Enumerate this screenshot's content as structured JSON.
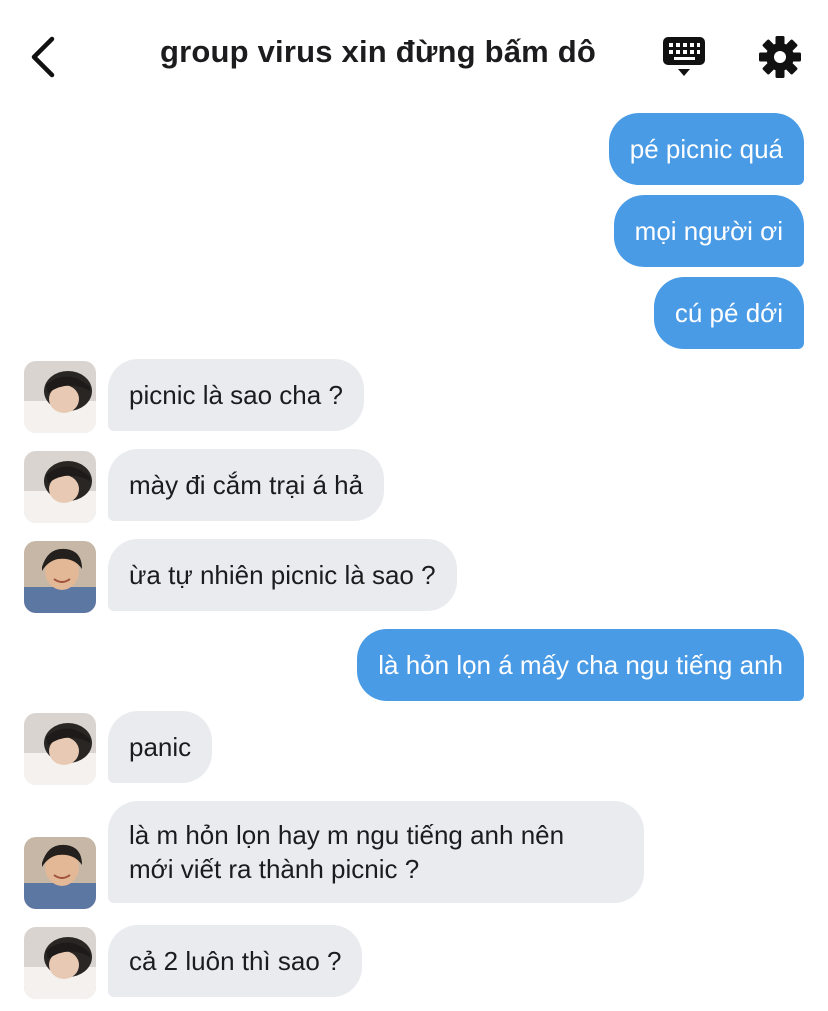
{
  "header": {
    "title": "group virus xin đừng bấm dô",
    "back_icon": "chevron-left-icon",
    "keyboard_icon": "keyboard-icon",
    "settings_icon": "gear-icon"
  },
  "colors": {
    "outgoing_bubble": "#4a9be6",
    "incoming_bubble": "#e9ebef",
    "text_dark": "#1c1c1e"
  },
  "messages": [
    {
      "direction": "out",
      "text": "pé picnic quá"
    },
    {
      "direction": "out",
      "text": "mọi người ơi"
    },
    {
      "direction": "out",
      "text": "cú pé dới"
    },
    {
      "direction": "in",
      "sender_avatar": "avatar-a",
      "text": "picnic là sao cha ?"
    },
    {
      "direction": "in",
      "sender_avatar": "avatar-a",
      "text": "mày đi cắm trại á hả"
    },
    {
      "direction": "in",
      "sender_avatar": "avatar-b",
      "text": "ừa tự nhiên picnic là sao ?"
    },
    {
      "direction": "out",
      "text": "là hỏn lọn á mấy cha ngu tiếng anh"
    },
    {
      "direction": "in",
      "sender_avatar": "avatar-a",
      "text": "panic"
    },
    {
      "direction": "in",
      "sender_avatar": "avatar-b",
      "text_lines": [
        "là m hỏn lọn hay m ngu tiếng anh nên",
        "mới viết ra thành picnic ?"
      ]
    },
    {
      "direction": "in",
      "sender_avatar": "avatar-a",
      "text": "cả 2 luôn thì sao ?"
    }
  ]
}
